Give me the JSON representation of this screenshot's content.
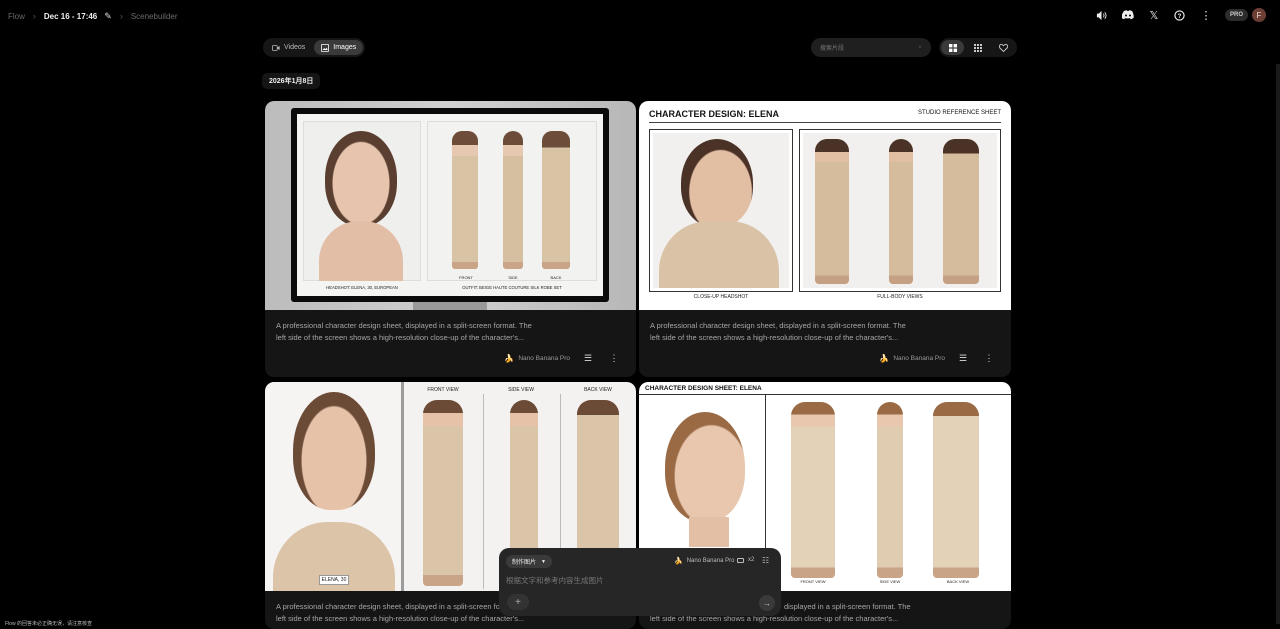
{
  "topbar": {
    "app": "Flow",
    "project": "Dec 16 - 17:46",
    "section": "Scenebuilder",
    "badge": "PRO",
    "avatar_letter": "F",
    "icons": [
      "volume-icon",
      "discord-icon",
      "x-logo-icon",
      "help-icon",
      "more-icon"
    ]
  },
  "tabs": [
    {
      "label": "Videos",
      "icon": "video-icon",
      "selected": false
    },
    {
      "label": "Images",
      "icon": "image-icon",
      "selected": true
    }
  ],
  "search": {
    "placeholder": "搜索片段"
  },
  "view_toggle": [
    "grid-large-icon",
    "grid-small-icon",
    "heart-icon"
  ],
  "date_chip": "2026年1月8日",
  "cards": [
    {
      "title": "",
      "caption_left": "HEADSHOT: ELENA, 30, EUROPEAN",
      "caption_right": "OUTFIT: BEIGE HAUTE COUTURE SILK ROBE SET",
      "view_labels": [
        "FRONT",
        "SIDE",
        "BACK"
      ],
      "desc1": "A professional character design sheet, displayed in a split-screen format. The",
      "desc2": "left side of the screen shows a high-resolution close-up of the character's...",
      "model": "Nano Banana Pro"
    },
    {
      "title": "CHARACTER DESIGN: ELENA",
      "subtitle": "STUDIO REFERENCE SHEET",
      "caption_left": "CLOSE-UP HEADSHOT",
      "caption_right": "FULL-BODY VIEWS",
      "desc1": "A professional character design sheet, displayed in a split-screen format. The",
      "desc2": "left side of the screen shows a high-resolution close-up of the character's...",
      "model": "Nano Banana Pro"
    },
    {
      "caption_left": "ELENA, 30",
      "view_labels": [
        "FRONT VIEW",
        "SIDE VIEW",
        "BACK VIEW"
      ],
      "desc1": "A professional character design sheet, displayed in a split-screen format. The",
      "desc2": "left side of the screen shows a high-resolution close-up of the character's..."
    },
    {
      "title": "CHARACTER DESIGN SHEET: ELENA",
      "view_labels": [
        "FRONT VIEW",
        "SIDE VIEW",
        "BACK VIEW"
      ],
      "desc1": "displayed in a split-screen format. The",
      "desc2": "left side of the screen shows a high-resolution close-up of the character's..."
    }
  ],
  "composer": {
    "mode": "制作图片",
    "model": "Nano Banana Pro",
    "count": "x2",
    "placeholder": "根据文字和参考内容生成图片"
  },
  "bottom_note": "Flow 的回答未必正确无误，请注意核查"
}
